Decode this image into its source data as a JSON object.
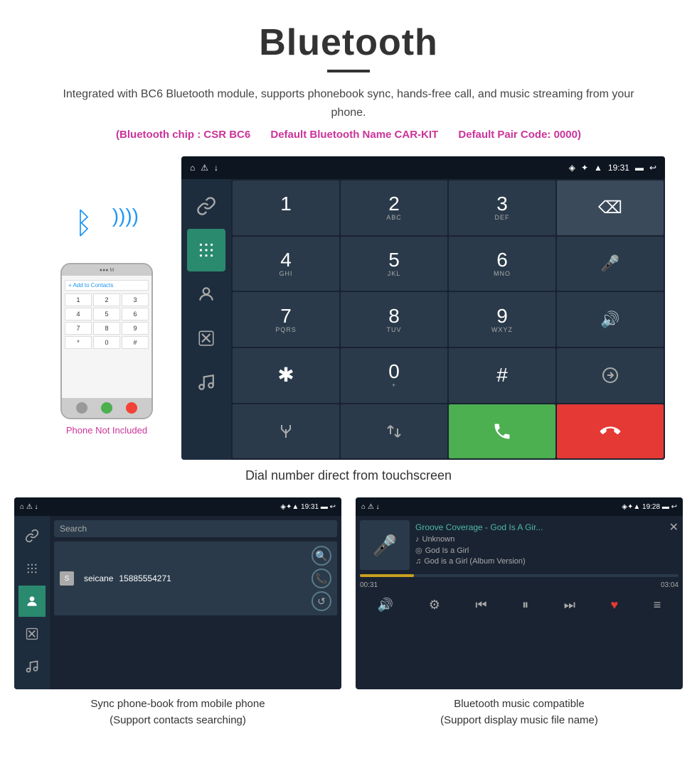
{
  "page": {
    "title": "Bluetooth",
    "subtitle": "Integrated with BC6 Bluetooth module, supports phonebook sync, hands-free call, and music streaming from your phone.",
    "specs": {
      "chip": "(Bluetooth chip : CSR BC6",
      "name": "Default Bluetooth Name CAR-KIT",
      "pair": "Default Pair Code: 0000)"
    },
    "main_caption": "Dial number direct from touchscreen",
    "phone_not_included": "Phone Not Included"
  },
  "car_screen": {
    "status_bar": {
      "left_icons": "⌂  ⚠  ↓",
      "time": "19:31",
      "right_icons": "📍 ✦ ▼ 🔋 ↩"
    },
    "dialpad": {
      "keys": [
        {
          "digit": "1",
          "sub": ""
        },
        {
          "digit": "2",
          "sub": "ABC"
        },
        {
          "digit": "3",
          "sub": "DEF"
        },
        {
          "digit": "⌫",
          "sub": ""
        },
        {
          "digit": "4",
          "sub": "GHI"
        },
        {
          "digit": "5",
          "sub": "JKL"
        },
        {
          "digit": "6",
          "sub": "MNO"
        },
        {
          "digit": "🎤",
          "sub": ""
        },
        {
          "digit": "7",
          "sub": "PQRS"
        },
        {
          "digit": "8",
          "sub": "TUV"
        },
        {
          "digit": "9",
          "sub": "WXYZ"
        },
        {
          "digit": "🔊",
          "sub": ""
        },
        {
          "digit": "*",
          "sub": ""
        },
        {
          "digit": "0",
          "sub": "+"
        },
        {
          "digit": "#",
          "sub": ""
        },
        {
          "digit": "⇅",
          "sub": ""
        },
        {
          "digit": "✱",
          "sub": ""
        },
        {
          "digit": "⇅",
          "sub": ""
        },
        {
          "digit": "📞",
          "sub": ""
        },
        {
          "digit": "📞",
          "sub": ""
        }
      ]
    }
  },
  "phonebook_screen": {
    "status_bar": {
      "left": "⌂  ⚠  ↓",
      "time": "19:31",
      "right": "📍✦▼ 🔋 ↩"
    },
    "search_placeholder": "Search",
    "contact": {
      "initial": "S",
      "name": "seicane",
      "phone": "15885554271"
    },
    "caption_line1": "Sync phone-book from mobile phone",
    "caption_line2": "(Support contacts searching)"
  },
  "music_screen": {
    "status_bar": {
      "left": "⌂  ⚠  ↓",
      "time": "19:28",
      "right": "📍✦▼ 🔋 ↩"
    },
    "track_title": "Groove Coverage - God Is A Gir...",
    "artist": "Unknown",
    "album": "God Is a Girl",
    "song": "God is a Girl (Album Version)",
    "time_current": "00:31",
    "time_total": "03:04",
    "progress_percent": 17,
    "caption_line1": "Bluetooth music compatible",
    "caption_line2": "(Support display music file name)"
  },
  "icons": {
    "bluetooth": "⚡",
    "link": "🔗",
    "keypad": "⌨",
    "contacts": "👤",
    "phone": "📞",
    "music": "♪",
    "search": "🔍",
    "call": "📞",
    "refresh": "↺",
    "volume": "🔊",
    "mute": "🎤",
    "shuffle": "⇄",
    "repeat": "↻",
    "prev": "⏮",
    "play": "⏸",
    "next": "⏭",
    "heart": "♥",
    "list": "≡",
    "close": "✕"
  }
}
